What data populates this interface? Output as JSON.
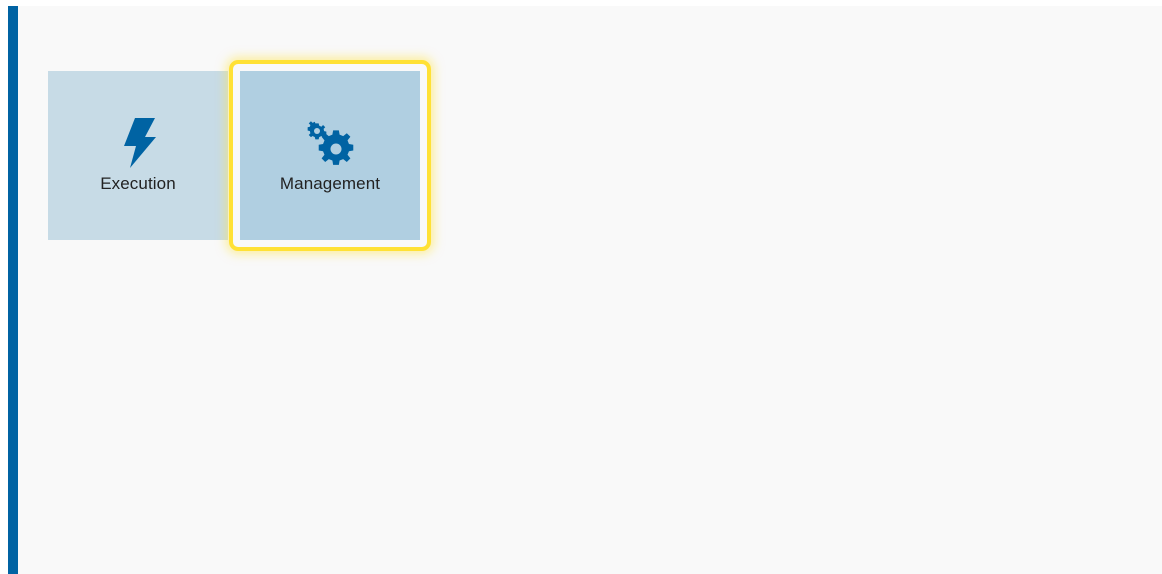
{
  "colors": {
    "accent_bar": "#0063a3",
    "tile_execution_bg": "#c7dbe6",
    "tile_management_bg": "#b0cfe1",
    "icon_color": "#0063a3",
    "selection_highlight": "#ffe135"
  },
  "tiles": [
    {
      "label": "Execution",
      "icon": "lightning-bolt-icon",
      "selected": false
    },
    {
      "label": "Management",
      "icon": "gears-icon",
      "selected": true
    }
  ]
}
